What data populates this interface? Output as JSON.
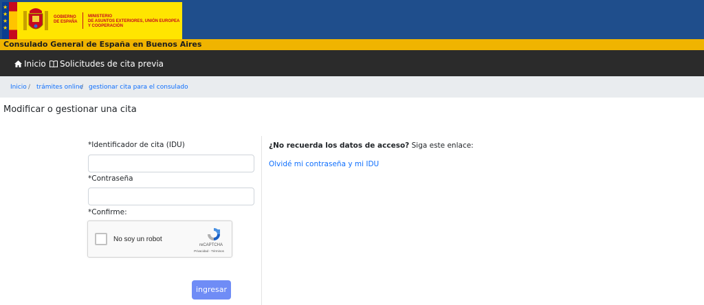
{
  "header": {
    "gov_line1": "GOBIERNO",
    "gov_line2": "DE ESPAÑA",
    "ministry_line1": "MINISTERIO",
    "ministry_line2": "DE ASUNTOS EXTERIORES, UNIÓN EUROPEA",
    "ministry_line3": "Y COOPERACIÓN",
    "consulate_name": "Consulado General de España en Buenos Aires",
    "colors": {
      "banner": "#1f4e8c",
      "gov_block": "#ffe500",
      "consulate_bar": "#f0b400",
      "navbar": "#2b2b2b"
    }
  },
  "nav": {
    "home": {
      "label": "Inicio",
      "icon": "home-icon"
    },
    "appointments": {
      "label": "Solicitudes de cita previa",
      "icon": "book-icon"
    }
  },
  "breadcrumb": {
    "items": [
      "Inicio",
      "trámites online",
      "gestionar cita para el consulado"
    ],
    "separator": "/"
  },
  "page": {
    "title": "Modificar o gestionar una cita"
  },
  "form": {
    "idu_label": "*Identificador de cita (IDU)",
    "idu_value": "",
    "password_label": "*Contraseña",
    "password_value": "",
    "confirm_label": "*Confirme:",
    "submit_label": "ingresar",
    "submit_color": "#6f8cf6"
  },
  "recaptcha": {
    "checkbox_label": "No soy un robot",
    "brand": "reCAPTCHA",
    "links": "Privacidad - Términos"
  },
  "help": {
    "question": "¿No recuerda los datos de acceso?",
    "prompt": "Siga este enlace:",
    "link": "Olvidé mi contraseña y mi IDU"
  }
}
